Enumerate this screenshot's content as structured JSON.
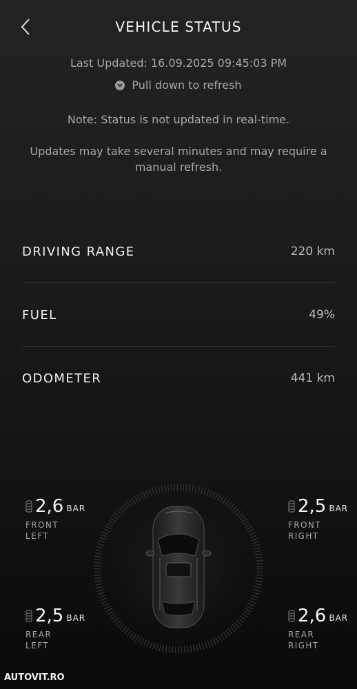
{
  "header": {
    "title": "VEHICLE STATUS",
    "back_icon": "chevron-left-icon"
  },
  "status": {
    "last_updated": "Last Updated: 16.09.2025 09:45:03 PM",
    "refresh_hint": "Pull down to refresh",
    "note": "Note: Status is not updated in real-time.",
    "note2": "Updates may take several minutes and may require a manual refresh."
  },
  "metrics": [
    {
      "label": "DRIVING RANGE",
      "value": "220 km"
    },
    {
      "label": "FUEL",
      "value": "49%"
    },
    {
      "label": "ODOMETER",
      "value": "441 km"
    }
  ],
  "tyres": {
    "unit": "BAR",
    "front_left": {
      "value": "2,6",
      "line1": "FRONT",
      "line2": "LEFT"
    },
    "front_right": {
      "value": "2,5",
      "line1": "FRONT",
      "line2": "RIGHT"
    },
    "rear_left": {
      "value": "2,5",
      "line1": "REAR",
      "line2": "LEFT"
    },
    "rear_right": {
      "value": "2,6",
      "line1": "REAR",
      "line2": "RIGHT"
    }
  },
  "watermark": "AUTOVIT.RO",
  "colors": {
    "background": "#1c1c1c",
    "text": "#e6e6e6",
    "muted": "#a8a8a8",
    "divider": "#3a3a3a"
  }
}
